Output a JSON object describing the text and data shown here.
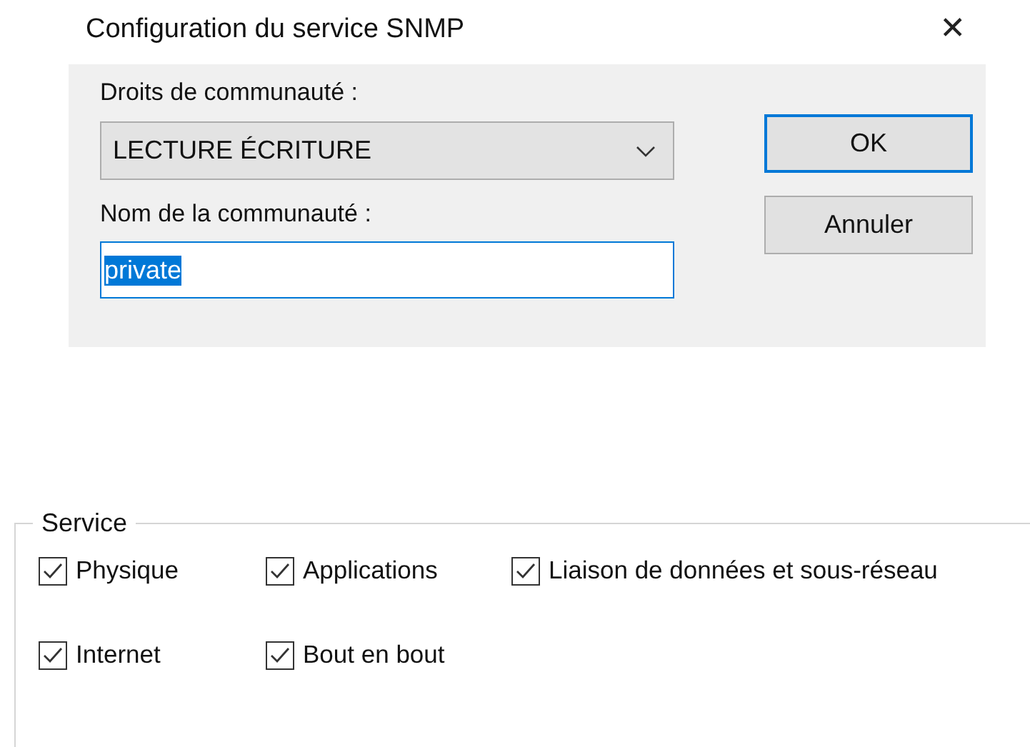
{
  "window": {
    "title": "Configuration du service SNMP",
    "close": "✕"
  },
  "community_rights": {
    "label": "Droits de communauté :",
    "value": "LECTURE ÉCRITURE"
  },
  "community_name": {
    "label": "Nom de la communauté :",
    "value": "private",
    "value_selected": true
  },
  "buttons": [
    {
      "label": "OK",
      "default": true
    },
    {
      "label": "Annuler",
      "default": false
    }
  ],
  "service": {
    "legend": "Service",
    "rows": [
      [
        {
          "label": "Physique",
          "checked": true
        },
        {
          "label": "Applications",
          "checked": true
        },
        {
          "label": "Liaison de données et sous-réseau",
          "checked": true
        }
      ],
      [
        {
          "label": "Internet",
          "checked": true
        },
        {
          "label": "Bout en bout",
          "checked": true
        }
      ]
    ]
  }
}
